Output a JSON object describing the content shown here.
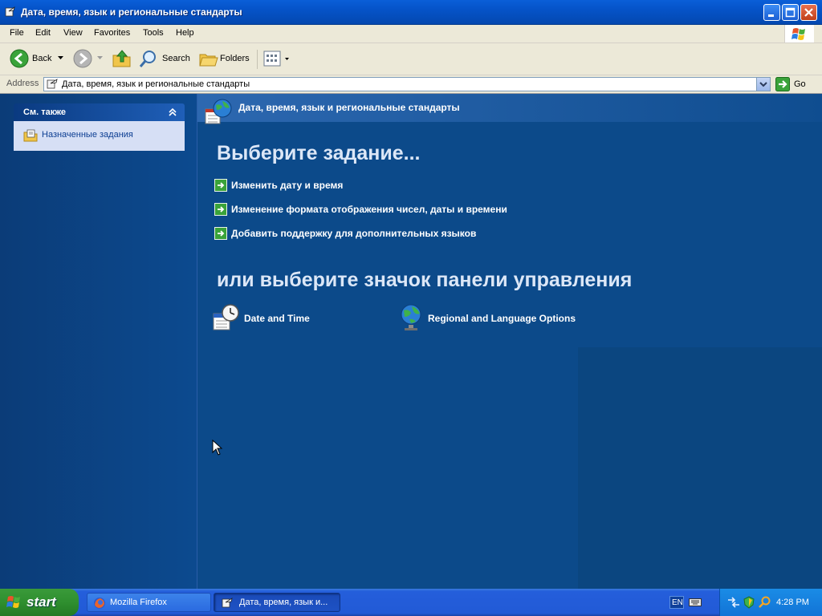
{
  "window": {
    "title": "Дата, время, язык и региональные стандарты",
    "minimize_label": "",
    "maximize_label": "",
    "close_label": ""
  },
  "menu": {
    "items": [
      "File",
      "Edit",
      "View",
      "Favorites",
      "Tools",
      "Help"
    ]
  },
  "toolbar": {
    "back_label": "Back",
    "search_label": "Search",
    "folders_label": "Folders"
  },
  "address": {
    "label": "Address",
    "value": "Дата, время, язык и региональные стандарты",
    "go_label": "Go"
  },
  "sidebar": {
    "section_title": "См. также",
    "items": [
      {
        "label": "Назначенные задания",
        "icon": "scheduled-tasks-icon"
      }
    ]
  },
  "main": {
    "header_title": "Дата, время, язык и региональные стандарты",
    "pick_task_heading": "Выберите задание...",
    "tasks": [
      {
        "label": "Изменить дату и время"
      },
      {
        "label": "Изменение формата отображения чисел, даты и времени"
      },
      {
        "label": "Добавить поддержку для дополнительных языков"
      }
    ],
    "pick_icon_heading": "или выберите значок панели управления",
    "icons": [
      {
        "label": "Date and Time",
        "icon": "date-time-icon"
      },
      {
        "label": "Regional and Language Options",
        "icon": "globe-icon"
      }
    ]
  },
  "taskbar": {
    "start_label": "start",
    "buttons": [
      {
        "label": "Mozilla Firefox",
        "icon": "firefox-icon",
        "active": false
      },
      {
        "label": "Дата, время, язык и...",
        "icon": "control-panel-icon",
        "active": true
      }
    ],
    "language": "EN",
    "clock": "4:28 PM"
  },
  "colors": {
    "titlebar": "#0553c8",
    "content_bg": "#0c4a8a",
    "taskbar": "#245edb",
    "start_green": "#2f8f2f",
    "task_arrow_green": "#3aa33a"
  }
}
